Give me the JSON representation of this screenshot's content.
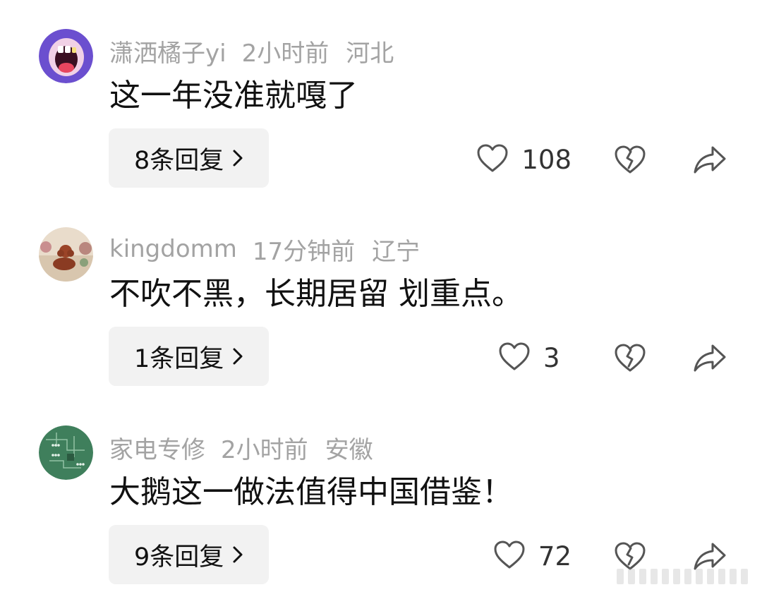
{
  "comments": [
    {
      "username": "潇洒橘子yi",
      "time": "2小时前",
      "location": "河北",
      "text": "这一年没准就嘎了",
      "reply_label": "8条回复",
      "likes": "108",
      "avatar": "cartoon-mouth-avatar"
    },
    {
      "username": "kingdomm",
      "time": "17分钟前",
      "location": "辽宁",
      "text": "不吹不黑，长期居留 划重点。",
      "reply_label": "1条回复",
      "likes": "3",
      "avatar": "poodle-photo-avatar"
    },
    {
      "username": "家电专修",
      "time": "2小时前",
      "location": "安徽",
      "text": "大鹅这一做法值得中国借鉴！",
      "reply_label": "9条回复",
      "likes": "72",
      "avatar": "circuit-board-avatar"
    }
  ],
  "icons": {
    "like": "heart-outline-icon",
    "dislike": "broken-heart-icon",
    "share": "share-arrow-icon",
    "reply_chevron": "chevron-right-icon"
  },
  "colors": {
    "meta_text": "#a3a3a3",
    "button_bg": "#f2f2f2",
    "icon_stroke": "#555555"
  }
}
